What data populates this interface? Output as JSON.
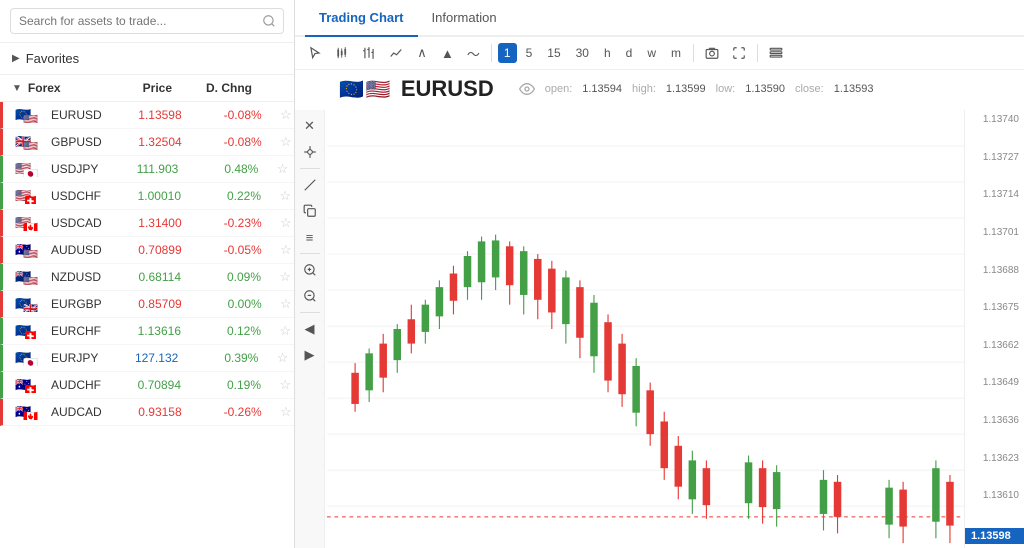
{
  "search": {
    "placeholder": "Search for assets to trade..."
  },
  "favorites": {
    "label": "Favorites",
    "arrow": "▶"
  },
  "forex": {
    "section_label": "Forex",
    "columns": [
      "Price",
      "D. Chng"
    ],
    "arrow": "▼",
    "assets": [
      {
        "name": "EURUSD",
        "price": "1.13598",
        "change": "-0.08%",
        "change_type": "negative",
        "price_type": "red",
        "flag1": "🇪🇺",
        "flag2": "🇺🇸",
        "border": "red"
      },
      {
        "name": "GBPUSD",
        "price": "1.32504",
        "change": "-0.08%",
        "change_type": "negative",
        "price_type": "red",
        "flag1": "🇬🇧",
        "flag2": "🇺🇸",
        "border": "red"
      },
      {
        "name": "USDJPY",
        "price": "111.903",
        "change": "0.48%",
        "change_type": "positive",
        "price_type": "green",
        "flag1": "🇺🇸",
        "flag2": "🇯🇵",
        "border": "green"
      },
      {
        "name": "USDCHF",
        "price": "1.00010",
        "change": "0.22%",
        "change_type": "positive",
        "price_type": "green",
        "flag1": "🇺🇸",
        "flag2": "🇨🇭",
        "border": "green"
      },
      {
        "name": "USDCAD",
        "price": "1.31400",
        "change": "-0.23%",
        "change_type": "negative",
        "price_type": "red",
        "flag1": "🇺🇸",
        "flag2": "🇨🇦",
        "border": "red"
      },
      {
        "name": "AUDUSD",
        "price": "0.70899",
        "change": "-0.05%",
        "change_type": "negative",
        "price_type": "red",
        "flag1": "🇦🇺",
        "flag2": "🇺🇸",
        "border": "red"
      },
      {
        "name": "NZDUSD",
        "price": "0.68114",
        "change": "0.09%",
        "change_type": "positive",
        "price_type": "green",
        "flag1": "🇳🇿",
        "flag2": "🇺🇸",
        "border": "green"
      },
      {
        "name": "EURGBP",
        "price": "0.85709",
        "change": "0.00%",
        "change_type": "positive",
        "price_type": "red",
        "flag1": "🇪🇺",
        "flag2": "🇬🇧",
        "border": "red"
      },
      {
        "name": "EURCHF",
        "price": "1.13616",
        "change": "0.12%",
        "change_type": "positive",
        "price_type": "green",
        "flag1": "🇪🇺",
        "flag2": "🇨🇭",
        "border": "green"
      },
      {
        "name": "EURJPY",
        "price": "127.132",
        "change": "0.39%",
        "change_type": "positive",
        "price_type": "blue",
        "flag1": "🇪🇺",
        "flag2": "🇯🇵",
        "border": "green"
      },
      {
        "name": "AUDCHF",
        "price": "0.70894",
        "change": "0.19%",
        "change_type": "positive",
        "price_type": "green",
        "flag1": "🇦🇺",
        "flag2": "🇨🇭",
        "border": "green"
      },
      {
        "name": "AUDCAD",
        "price": "0.93158",
        "change": "-0.26%",
        "change_type": "negative",
        "price_type": "red",
        "flag1": "🇦🇺",
        "flag2": "🇨🇦",
        "border": "red"
      }
    ]
  },
  "tabs": [
    {
      "id": "trading-chart",
      "label": "Trading Chart",
      "active": true
    },
    {
      "id": "information",
      "label": "Information",
      "active": false
    }
  ],
  "toolbar": {
    "tools": [
      {
        "id": "cursor",
        "symbol": "↖",
        "active": false
      },
      {
        "id": "candle-chart",
        "symbol": "⬛",
        "active": false
      },
      {
        "id": "bar-chart",
        "symbol": "📊",
        "active": false
      },
      {
        "id": "line-chart",
        "symbol": "📈",
        "active": false
      },
      {
        "id": "peak",
        "symbol": "∧",
        "active": false
      },
      {
        "id": "triangle",
        "symbol": "▲",
        "active": false
      },
      {
        "id": "wave",
        "symbol": "〜",
        "active": false
      }
    ],
    "timeframes": [
      {
        "id": "tf-1",
        "label": "1",
        "active": true
      },
      {
        "id": "tf-5",
        "label": "5",
        "active": false
      },
      {
        "id": "tf-15",
        "label": "15",
        "active": false
      },
      {
        "id": "tf-30",
        "label": "30",
        "active": false
      },
      {
        "id": "tf-h",
        "label": "h",
        "active": false
      },
      {
        "id": "tf-d",
        "label": "d",
        "active": false
      },
      {
        "id": "tf-w",
        "label": "w",
        "active": false
      },
      {
        "id": "tf-m",
        "label": "m",
        "active": false
      }
    ],
    "extra_tools": [
      {
        "id": "camera",
        "symbol": "📷",
        "active": false
      },
      {
        "id": "fullscreen",
        "symbol": "⛶",
        "active": false
      },
      {
        "id": "more",
        "symbol": "⊟",
        "active": false
      }
    ]
  },
  "chart": {
    "pair": "EURUSD",
    "flag1": "🇪🇺",
    "flag2": "🇺🇸",
    "ohlc": {
      "open_label": "open:",
      "open": "1.13594",
      "high_label": "high:",
      "high": "1.13599",
      "low_label": "low:",
      "low": "1.13590",
      "close_label": "close:",
      "close": "1.13593"
    },
    "current_price": "1.13598",
    "y_labels": [
      "1.13740",
      "1.13727",
      "1.13714",
      "1.13701",
      "1.13688",
      "1.13675",
      "1.13662",
      "1.13649",
      "1.13636",
      "1.13623",
      "1.13610",
      "1.13598"
    ]
  },
  "left_toolbar": {
    "buttons": [
      {
        "id": "close",
        "symbol": "✕"
      },
      {
        "id": "crosshair",
        "symbol": "⊕"
      },
      {
        "id": "line",
        "symbol": "📉"
      },
      {
        "id": "copy",
        "symbol": "⧉"
      },
      {
        "id": "menu",
        "symbol": "≡"
      },
      {
        "id": "zoom-in",
        "symbol": "🔍"
      },
      {
        "id": "zoom-out",
        "symbol": "🔎"
      },
      {
        "id": "arrow-left",
        "symbol": "◀"
      },
      {
        "id": "arrow-right",
        "symbol": "▶"
      }
    ]
  }
}
